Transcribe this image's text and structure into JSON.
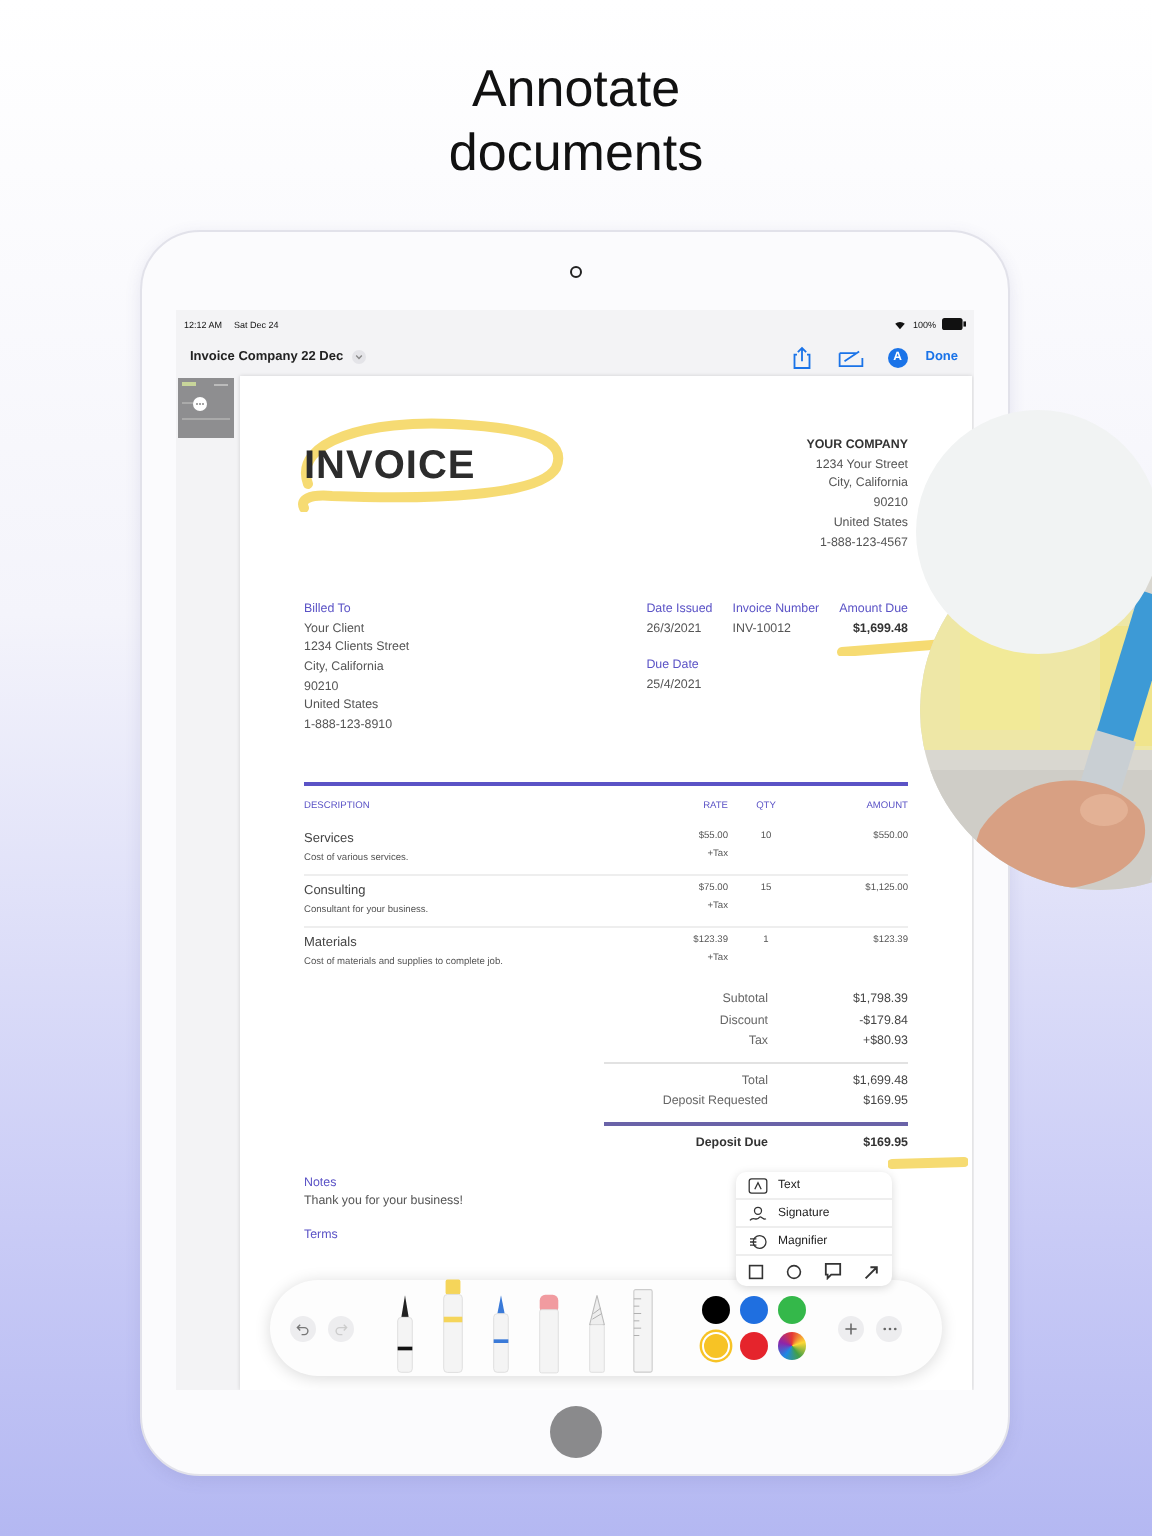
{
  "headline": "Annotate documents",
  "status_bar": {
    "time": "12:12 AM",
    "date": "Sat Dec 24",
    "battery": "100%"
  },
  "nav": {
    "title": "Invoice Company 22 Dec",
    "avatar": "A",
    "done": "Done"
  },
  "invoice": {
    "title": "INVOICE",
    "company": [
      "YOUR COMPANY",
      "1234 Your Street",
      "City, California",
      "90210",
      "United States",
      "1-888-123-4567"
    ],
    "billed_to": {
      "label": "Billed To",
      "lines": [
        "Your Client",
        "1234 Clients Street",
        "City, California",
        "90210",
        "United States",
        "1-888-123-8910"
      ]
    },
    "meta": [
      {
        "label": "Date Issued",
        "value": "26/3/2021",
        "emphasis": false
      },
      {
        "label": "Invoice Number",
        "value": "INV-10012",
        "emphasis": false
      },
      {
        "label": "Amount Due",
        "value": "$1,699.48",
        "emphasis": true
      },
      {
        "label": "Due Date",
        "value": "25/4/2021",
        "emphasis": false
      }
    ],
    "columns": [
      "DESCRIPTION",
      "RATE",
      "QTY",
      "AMOUNT"
    ],
    "rows": [
      {
        "name": "Services",
        "note": "Cost of various services.",
        "rate": "$55.00",
        "tax": "+Tax",
        "qty": "10",
        "amount": "$550.00"
      },
      {
        "name": "Consulting",
        "note": "Consultant for your business.",
        "rate": "$75.00",
        "tax": "+Tax",
        "qty": "15",
        "amount": "$1,125.00"
      },
      {
        "name": "Materials",
        "note": "Cost of materials and supplies to complete job.",
        "rate": "$123.39",
        "tax": "+Tax",
        "qty": "1",
        "amount": "$123.39"
      }
    ],
    "totals": [
      {
        "label": "Subtotal",
        "value": "$1,798.39",
        "kind": "line"
      },
      {
        "label": "Discount",
        "value": "-$179.84",
        "kind": "line"
      },
      {
        "label": "Tax",
        "value": "+$80.93",
        "kind": "line"
      },
      {
        "label": "Total",
        "value": "$1,699.48",
        "kind": "ruled"
      },
      {
        "label": "Deposit Requested",
        "value": "$169.95",
        "kind": "line"
      },
      {
        "label": "Deposit Due",
        "value": "$169.95",
        "kind": "due"
      }
    ],
    "notes": {
      "label": "Notes",
      "text": "Thank you for your business!"
    },
    "terms": {
      "label": "Terms"
    }
  },
  "popover": {
    "items": [
      "Text",
      "Signature",
      "Magnifier"
    ]
  },
  "toolbar": {
    "colors": [
      {
        "color": "#000000",
        "selected": false
      },
      {
        "color": "#1f6fe0",
        "selected": false
      },
      {
        "color": "#34b84a",
        "selected": false
      },
      {
        "color": "#f7c325",
        "selected": true
      },
      {
        "color": "#e5242c",
        "selected": false
      }
    ]
  }
}
